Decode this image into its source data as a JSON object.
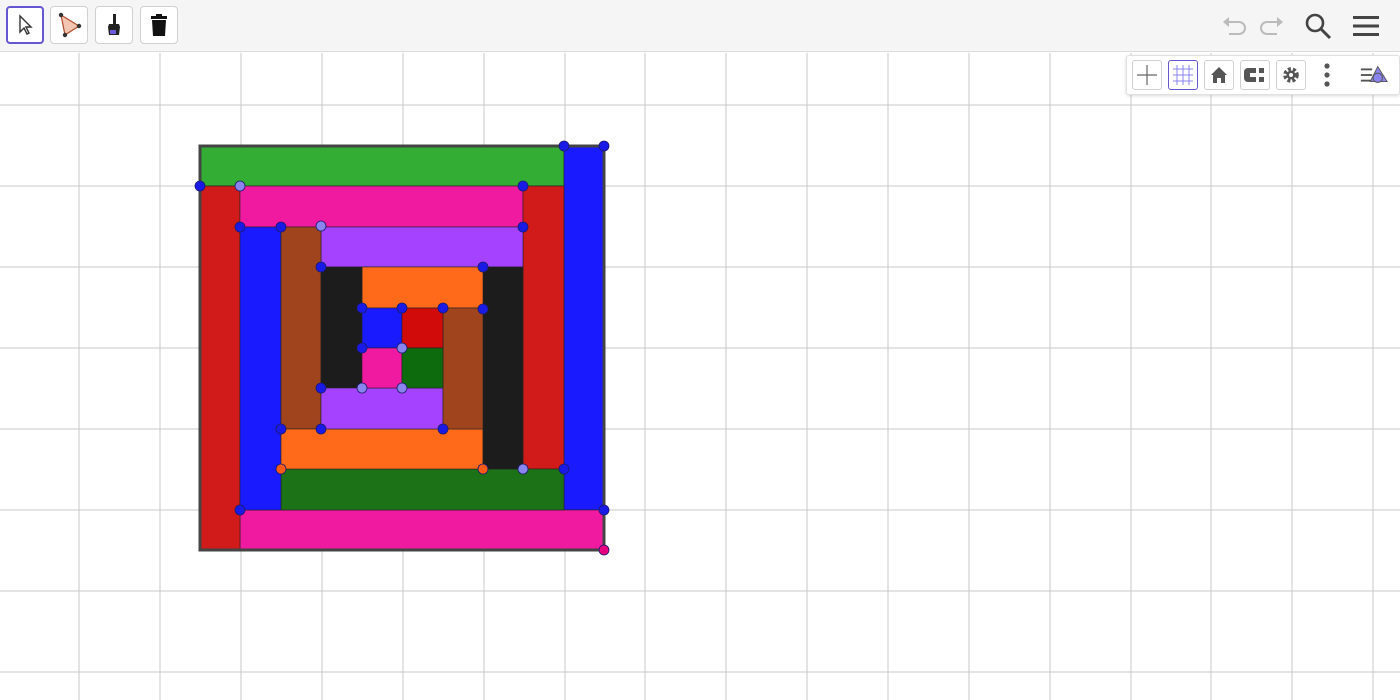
{
  "app": {
    "toolbar": {
      "tools": [
        {
          "name": "move-tool",
          "icon": "arrow-cursor-icon",
          "active": true
        },
        {
          "name": "polygon-tool",
          "icon": "triangle-polygon-icon",
          "active": false
        },
        {
          "name": "paint-tool",
          "icon": "paintbrush-icon",
          "active": false
        },
        {
          "name": "delete-tool",
          "icon": "trash-icon",
          "active": false
        }
      ],
      "header_buttons": [
        "undo-icon",
        "redo-icon",
        "search-icon",
        "hamburger-menu-icon"
      ]
    },
    "style_bar": {
      "buttons": [
        "axes-icon",
        "grid-icon",
        "home-icon",
        "point-capture-icon",
        "settings-gear-icon",
        "more-vertical-icon",
        "algebra-toggle-icon"
      ],
      "grid_active": true
    },
    "colors": {
      "accent": "#6557d2",
      "green": "#34ad34",
      "red": "#d11b1b",
      "pink": "#f01aa1",
      "blue": "#1a1aff",
      "purple": "#a442ff",
      "brown": "#a0441e",
      "black": "#1c1c1c",
      "orange": "#ff6a1a",
      "dark_green": "#1c7317",
      "deep_green": "#0d6b0d",
      "point_blue": "#1a1ae6",
      "point_light": "#8a84ef",
      "point_orange": "#ff5a1a",
      "point_pink": "#e6007e"
    }
  }
}
